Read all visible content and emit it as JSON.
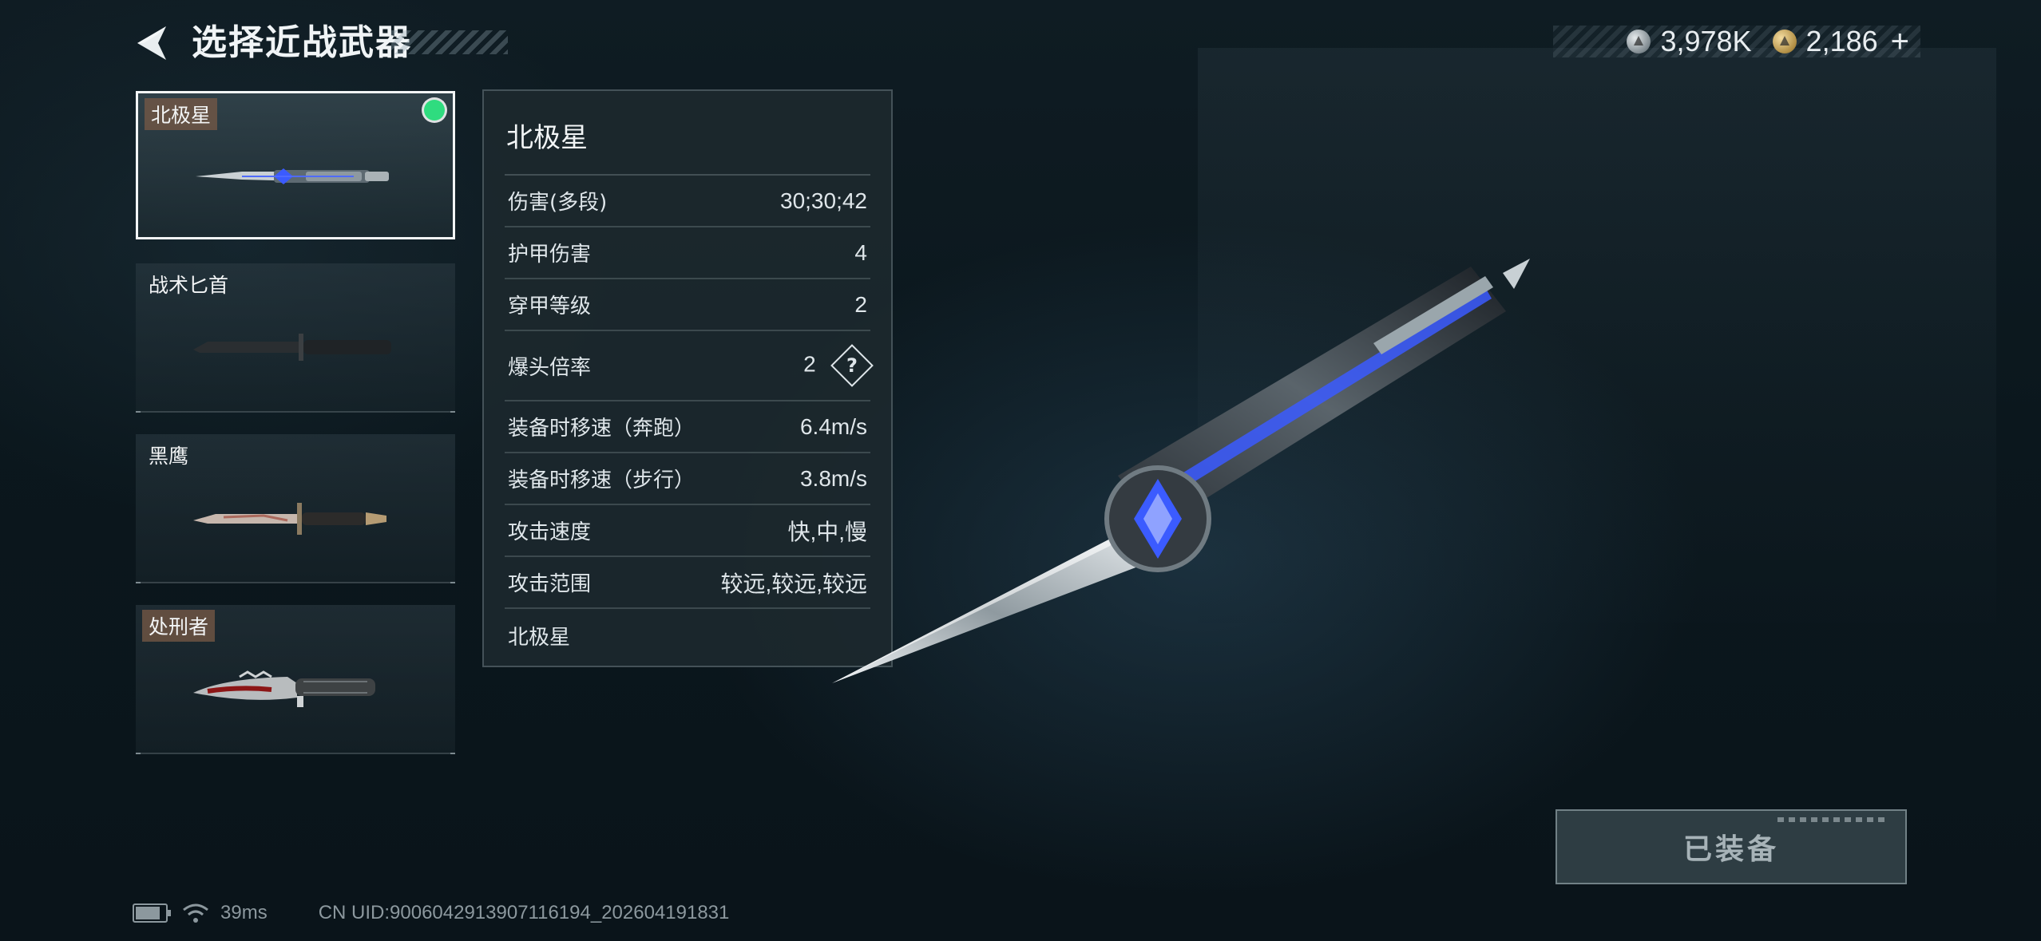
{
  "header": {
    "title": "选择近战武器"
  },
  "currency": {
    "silver_amount": "3,978K",
    "gold_amount": "2,186",
    "plus_label": "+",
    "icons": [
      "silver-coin-icon",
      "gold-coin-icon"
    ]
  },
  "weapon_list": [
    {
      "name": "北极星",
      "selected": true,
      "equipped": true,
      "tagged": true
    },
    {
      "name": "战术匕首",
      "selected": false,
      "equipped": false,
      "tagged": false
    },
    {
      "name": "黑鹰",
      "selected": false,
      "equipped": false,
      "tagged": false
    },
    {
      "name": "处刑者",
      "selected": false,
      "equipped": false,
      "tagged": true
    }
  ],
  "stats": {
    "title": "北极星",
    "rows": [
      {
        "label": "伤害(多段)",
        "value": "30;30;42"
      },
      {
        "label": "护甲伤害",
        "value": "4"
      },
      {
        "label": "穿甲等级",
        "value": "2"
      },
      {
        "label": "爆头倍率",
        "value": "2",
        "help": "?"
      },
      {
        "label": "装备时移速（奔跑）",
        "value": "6.4m/s"
      },
      {
        "label": "装备时移速（步行）",
        "value": "3.8m/s"
      },
      {
        "label": "攻击速度",
        "value": "快,中,慢"
      },
      {
        "label": "攻击范围",
        "value": "较远,较远,较远"
      }
    ],
    "footer": "北极星"
  },
  "equip_button": {
    "label": "已装备"
  },
  "status_bar": {
    "ping": "39ms",
    "uid": "CN UID:9006042913907116194_202604191831"
  },
  "colors": {
    "equipped_dot": "#2fdc7f",
    "tag_bg": "#785a46",
    "blade_accent": "#3b5bff"
  }
}
